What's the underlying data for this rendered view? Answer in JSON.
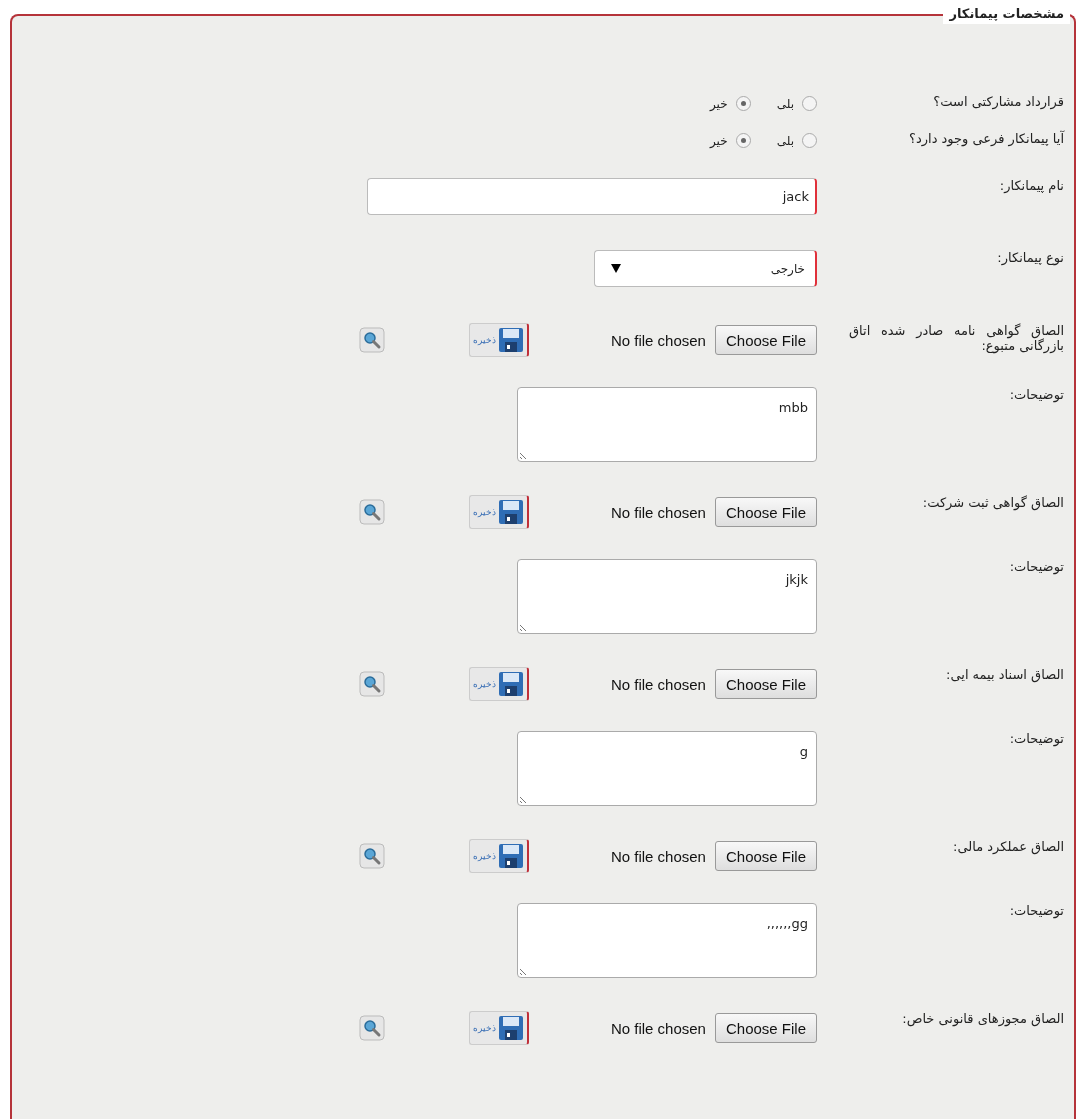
{
  "fieldset": {
    "legend": "مشخصات پیمانکار",
    "rows": [
      {
        "kind": "radio",
        "label": "قرارداد مشارکتی است؟",
        "options": [
          {
            "label": "بلی",
            "selected": false
          },
          {
            "label": "خیر",
            "selected": true
          }
        ]
      },
      {
        "kind": "radio",
        "label": "آیا پیمانکار فرعی وجود دارد؟",
        "options": [
          {
            "label": "بلی",
            "selected": false
          },
          {
            "label": "خیر",
            "selected": true
          }
        ]
      },
      {
        "kind": "text",
        "label": "نام پیمانکار:",
        "value": "jack",
        "required": true
      },
      {
        "kind": "select",
        "label": "نوع پیمانکار:",
        "value": "خارجی",
        "required": true
      },
      {
        "kind": "file",
        "label": "الصاق گواهی نامه صادر شده اتاق بازرگانی متبوع:",
        "button": "Choose File",
        "status": "No file chosen",
        "save": "ذخیره"
      },
      {
        "kind": "textarea",
        "label": "توضیحات:",
        "value": "mbb"
      },
      {
        "kind": "file",
        "label": "الصاق گواهی ثبت شرکت:",
        "button": "Choose File",
        "status": "No file chosen",
        "save": "ذخیره"
      },
      {
        "kind": "textarea",
        "label": "توضیحات:",
        "value": "jkjk"
      },
      {
        "kind": "file",
        "label": "الصاق اسناد بیمه ایی:",
        "button": "Choose File",
        "status": "No file chosen",
        "save": "ذخیره"
      },
      {
        "kind": "textarea",
        "label": "توضیحات:",
        "value": "g"
      },
      {
        "kind": "file",
        "label": "الصاق عملکرد مالی:",
        "button": "Choose File",
        "status": "No file chosen",
        "save": "ذخیره"
      },
      {
        "kind": "textarea",
        "label": "توضیحات:",
        "value": ",,,,,,gg"
      },
      {
        "kind": "file",
        "label": "الصاق مجوزهای قانونی خاص:",
        "button": "Choose File",
        "status": "No file chosen",
        "save": "ذخیره"
      }
    ]
  }
}
